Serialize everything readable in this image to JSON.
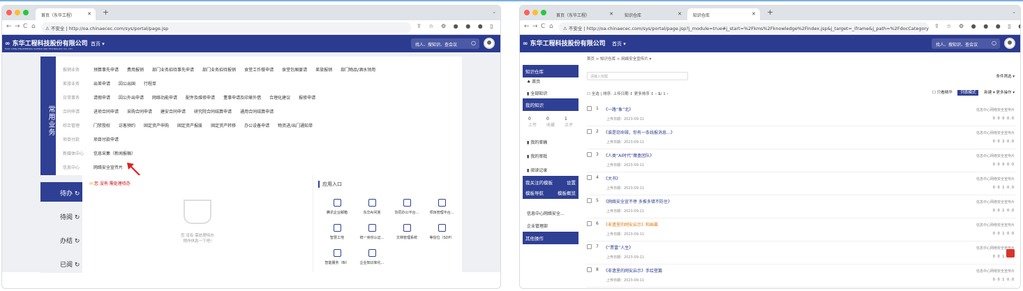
{
  "left": {
    "tab_title": "首页（东华工程）",
    "url_prefix": "不安全",
    "url": "http://oa.chinaecec.com/sys/portal/page.jsp",
    "app_logo": "东华工程科技股份有限公司",
    "app_logo_sub": "EAST CHINA ENGINEERING SCIENCE AND TECHNOLOGY CO., LTD.",
    "home_menu": "首页 ▾",
    "search_placeholder": "找人、搜知识、查会议",
    "side_label": "常用业务",
    "menu_rows": [
      {
        "cat": "报销业务",
        "items": [
          "预算事先申请",
          "费用报销",
          "部门业务招待事先申请",
          "部门业务招待报销",
          "食堂工作餐申请",
          "食堂包厢宴请",
          "差旅报销",
          "部门物品/酒水领用"
        ]
      },
      {
        "cat": "差旅业务",
        "items": [
          "出差申请",
          "因公出国",
          "行程单"
        ]
      },
      {
        "cat": "日常事务",
        "items": [
          "请假申请",
          "因公外出申请",
          "网络功能申请",
          "配件及维修申请",
          "董事申请及印章外借",
          "合理化建议",
          "报修申请"
        ]
      },
      {
        "cat": "合同申请",
        "items": [
          "进项合同申请",
          "采购合同申请",
          "建安合同申请",
          "研究院合同结算申请",
          "通用合同结算申请"
        ]
      },
      {
        "cat": "综合管理",
        "items": [
          "门禁授权",
          "访客预约",
          "固定资产申购",
          "固定资产报废",
          "固定资产转移",
          "办公设备申请",
          "物资进/出门通知单"
        ]
      },
      {
        "cat": "项目付款",
        "items": [
          "项目付款申请"
        ]
      },
      {
        "cat": "新媒体中心",
        "items": [
          "信息采集（新闻报稿）"
        ]
      },
      {
        "cat": "信息中心",
        "items": [
          "网络安全宣传片"
        ]
      }
    ],
    "task_tabs": [
      "待办",
      "待阅",
      "办结",
      "已阅"
    ],
    "task_header": "您 没有 需处理待办",
    "task_empty": "您 没有 需处理待办",
    "task_empty2": "稍作休息一下吧!",
    "apps_title": "应用入口",
    "apps": [
      "腾讯企业邮箱",
      "东华AI问答",
      "协同办公平台...",
      "项目管理平台...",
      "智慧工地",
      "统一身份认证...",
      "文档管理系统",
      "等信位（SDP）",
      "智能服务（BI）",
      "企业知识库化..."
    ]
  },
  "right": {
    "tabs": [
      "首页（东华工程）",
      "知识仓库",
      "知识仓库"
    ],
    "url_prefix": "不安全",
    "url": "http://oa.chinaecec.com/sys/portal/page.jsp?j_module=true#j_start=%2Fkms%2Fknowledge%2Findex.jsp&j_target=_iframe&j_path=%2FdocCategory&docCategory=1609...",
    "app_logo": "东华工程科技股份有限公司",
    "home_menu": "首页 ▾",
    "search_placeholder": "找人、搜知识、查会议",
    "sidebar": {
      "title": "知识仓库",
      "home": "首页",
      "all": "全部知识",
      "mine": "我的知识",
      "stats": [
        {
          "value": "0",
          "label": "上传"
        },
        {
          "value": "0",
          "label": "收藏"
        },
        {
          "value": "1",
          "label": "点评"
        }
      ],
      "items": [
        "我的草稿",
        "我的审批",
        "阅读记录"
      ],
      "tpl_title": "我关注的模板",
      "tpl_action": "设置",
      "tpl_nav": "模板导航",
      "tpl_nav_action": "模板概览",
      "cats": [
        "信息中心网络安全...",
        "企业管理部"
      ],
      "other": "其他操作"
    },
    "breadcrumb": "首页 > 知识仓库 > 网络安全宣传片 ▾",
    "filter_placeholder": "请输入标题",
    "more_filter": "条件筛选 ▾",
    "toolbar": {
      "select_all": "全选",
      "sort": "排序:",
      "upload_date": "上传日期 ↕",
      "update_time": "更多排序 ↕",
      "page": "1",
      "page_total": "/ 1",
      "only_fav": "只看精华",
      "view": "列表模式",
      "new": "新建 ▾",
      "more": "更多操作 ▾"
    },
    "items": [
      {
        "n": "1",
        "title": "《一路“象”北》",
        "date": "上传日期：2023-09-11",
        "src": "信息中心网络安全宣传片",
        "stats": "0   0   0   0.0"
      },
      {
        "n": "2",
        "title": "《谁是窃命贼，你有一条线报消息...》",
        "date": "上传日期：2023-09-11",
        "src": "信息中心网络安全宣传片",
        "stats": "0   0   2   0.0"
      },
      {
        "n": "3",
        "title": "《人类“AI时代”魔盒团队》",
        "date": "上传日期：2023-09-11",
        "src": "信息中心网络安全宣传片",
        "stats": "0   0   0   0.0"
      },
      {
        "n": "4",
        "title": "《大书》",
        "date": "上传日期：2023-09-11",
        "src": "信息中心网络安全宣传片",
        "stats": "0   0   1   0.0"
      },
      {
        "n": "5",
        "title": "《网络安全宣不停 多推多错不防住》",
        "date": "上传日期：2023-09-11",
        "src": "信息中心网络安全宣传片",
        "stats": "0   0   1   0.0"
      },
      {
        "n": "6",
        "title": "《非遗里的网安启示》和画幕",
        "date": "上传日期：2023-09-11",
        "src": "信息中心网络安全宣传片",
        "stats": "0   0   1   0.0"
      },
      {
        "n": "7",
        "title": "《“票富”人生》",
        "date": "上传日期：2023-09-11",
        "src": "信息中心网络安全宣传片",
        "stats": "0   0   1   0.0"
      },
      {
        "n": "8",
        "title": "《非遗里的网安启示》手绘登篇",
        "date": "上传日期：2023-09-11",
        "src": "信息中心网络安全宣传片",
        "stats": "0   0   1   0.0"
      }
    ]
  }
}
